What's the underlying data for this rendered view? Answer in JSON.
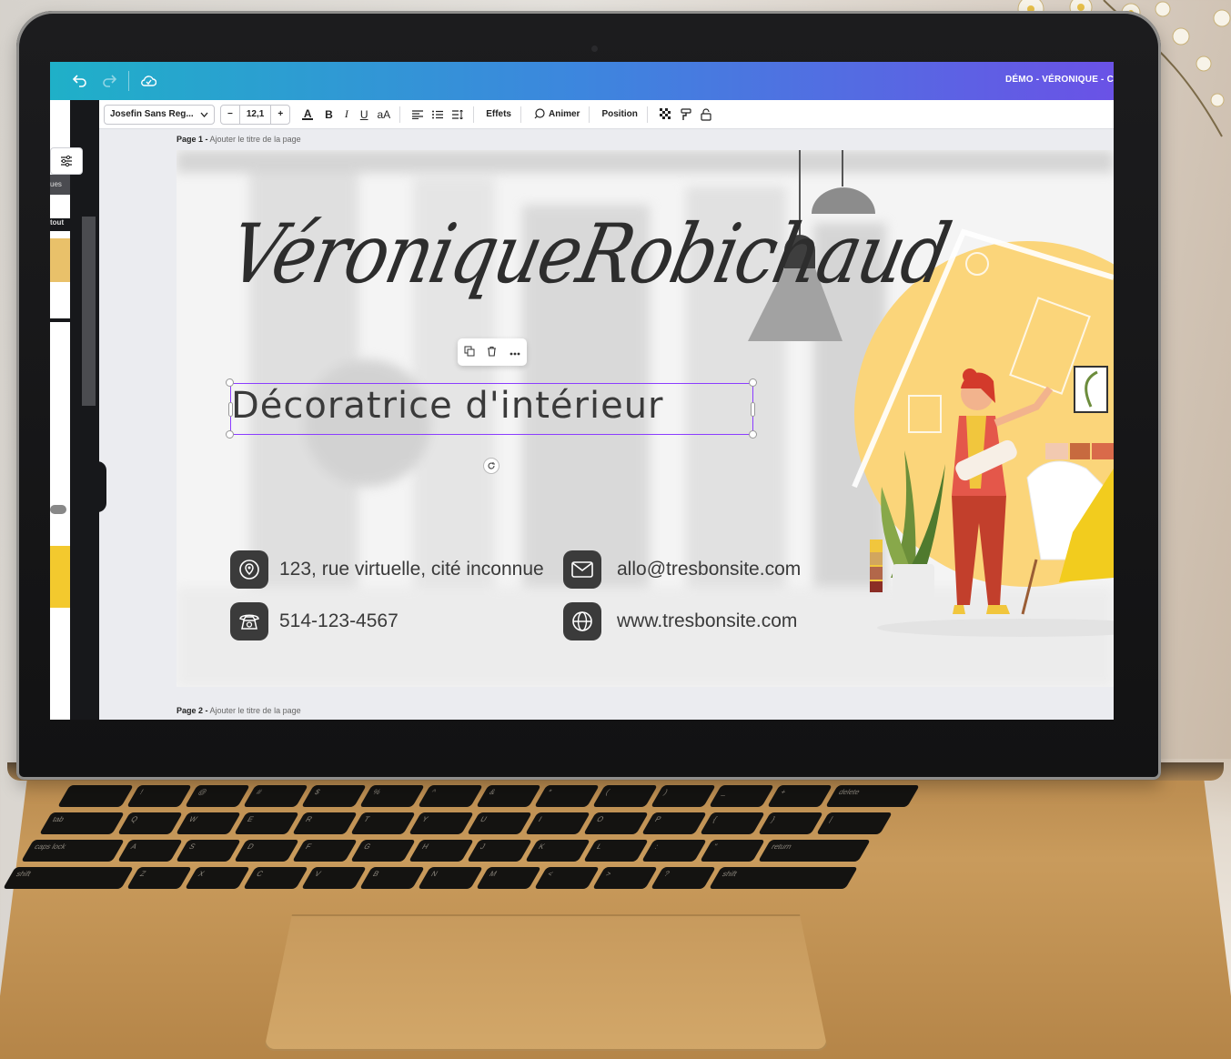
{
  "app": {
    "doc_title": "DÉMO - VÉRONIQUE - C",
    "topbar_icons": [
      "undo-icon",
      "redo-icon",
      "cloud-saved-icon"
    ]
  },
  "toolbar": {
    "font_name": "Josefin Sans Reg...",
    "size_minus": "−",
    "font_size": "12,1",
    "size_plus": "+",
    "text_color_glyph": "A",
    "bold": "B",
    "italic": "I",
    "underline": "U",
    "case": "aA",
    "effects": "Effets",
    "animate": "Animer",
    "position": "Position"
  },
  "pages": [
    {
      "label": "Page 1 -",
      "title_placeholder": "Ajouter le titre de la page"
    },
    {
      "label": "Page 2 -",
      "title_placeholder": "Ajouter le titre de la page"
    }
  ],
  "side_panel": {
    "fragment_1": "ues",
    "fragment_2": "tout"
  },
  "card": {
    "name": "VéroniqueRobichaud",
    "subtitle": "Décoratrice d'intérieur",
    "contacts": {
      "address": "123, rue virtuelle, cité inconnue",
      "phone": "514-123-4567",
      "email": "allo@tresbonsite.com",
      "website": "www.tresbonsite.com"
    }
  },
  "colors": {
    "topbar_gradient": [
      "#1fb0c8",
      "#3d86de",
      "#6a52e6"
    ],
    "selection": "#8b3dff",
    "icon_bg": "#3b3b3b",
    "accent_yellow": "#fbd57a"
  }
}
